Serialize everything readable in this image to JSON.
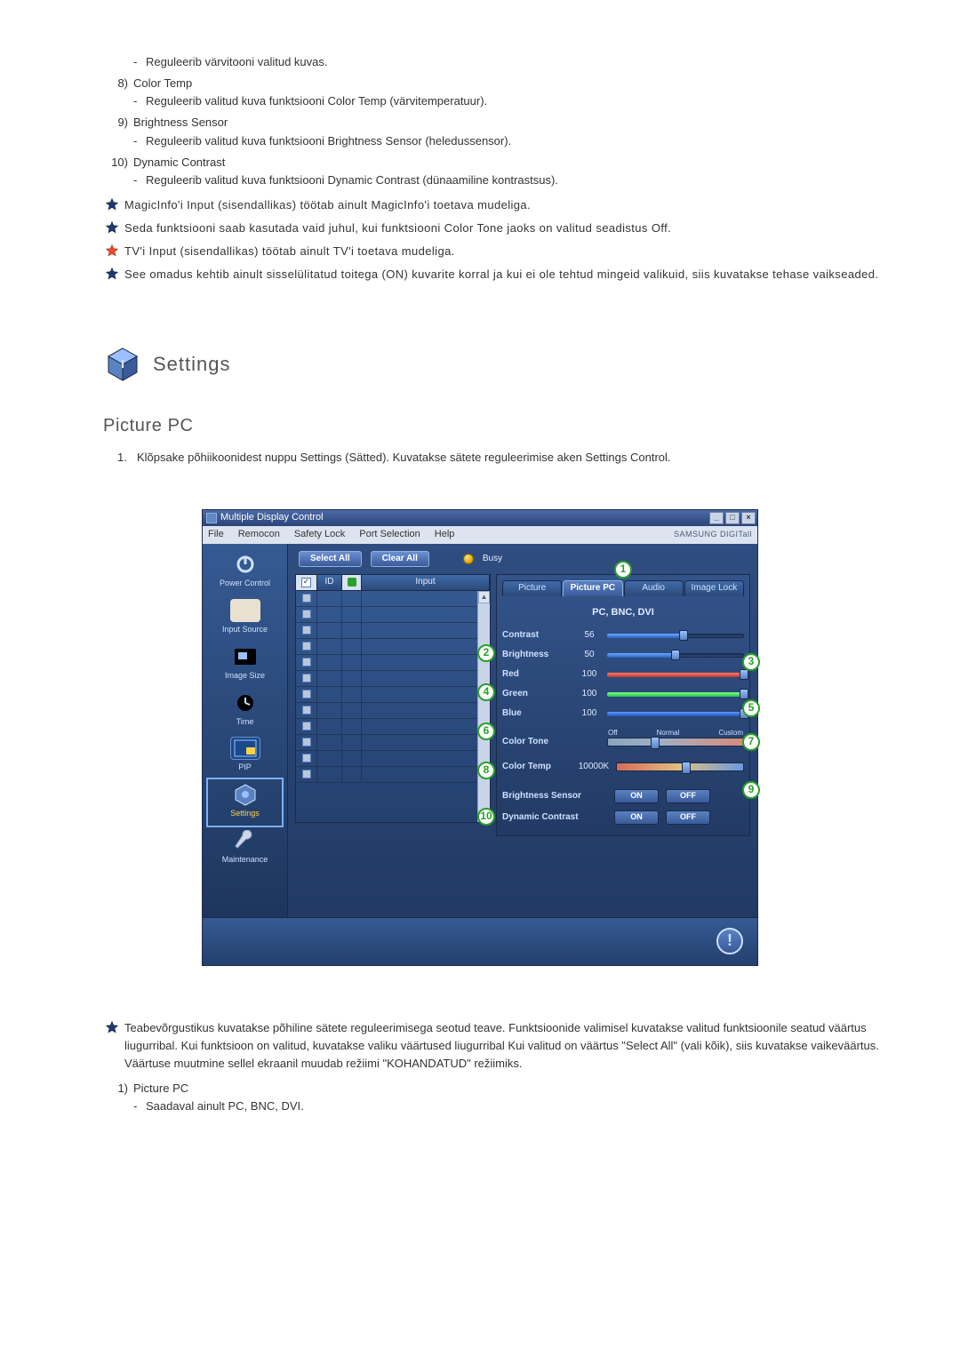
{
  "top_list": {
    "item0_sub": "Reguleerib värvitooni valitud kuvas.",
    "items": [
      {
        "num": "8)",
        "label": "Color Temp",
        "desc": "Reguleerib valitud kuva funktsiooni Color Temp (värvitemperatuur)."
      },
      {
        "num": "9)",
        "label": "Brightness Sensor",
        "desc": "Reguleerib valitud kuva funktsiooni Brightness Sensor (heledussensor)."
      },
      {
        "num": "10)",
        "label": "Dynamic Contrast",
        "desc": "Reguleerib valitud kuva funktsiooni Dynamic Contrast (dünaamiline kontrastsus)."
      }
    ]
  },
  "footnotes": [
    {
      "color": "navy",
      "text": "MagicInfo'i Input (sisendallikas) töötab ainult MagicInfo'i toetava mudeliga."
    },
    {
      "color": "navy",
      "text": "Seda funktsiooni saab kasutada vaid juhul, kui funktsiooni Color Tone jaoks on valitud seadistus Off."
    },
    {
      "color": "red",
      "text": "TV'i Input (sisendallikas) töötab ainult TV'i toetava mudeliga."
    },
    {
      "color": "navy",
      "text": "See omadus kehtib ainult sisselülitatud toitega (ON) kuvarite korral ja kui ei ole tehtud mingeid valikuid, siis kuvatakse tehase vaikseaded."
    }
  ],
  "settings_section": {
    "title": "Settings",
    "subheading": "Picture PC",
    "step_num": "1.",
    "step_text": "Klõpsake põhiikoonidest nuppu Settings (Sätted). Kuvatakse sätete reguleerimise aken Settings Control."
  },
  "mdc": {
    "title": "Multiple Display Control",
    "window_buttons": {
      "min": "_",
      "max": "□",
      "close": "×"
    },
    "menu": [
      "File",
      "Remocon",
      "Safety Lock",
      "Port Selection",
      "Help"
    ],
    "brand": "SAMSUNG DIGITall",
    "sidebar": [
      "Power Control",
      "Input Source",
      "Image Size",
      "Time",
      "PIP",
      "Settings",
      "Maintenance"
    ],
    "buttons": {
      "select_all": "Select All",
      "clear_all": "Clear All",
      "busy": "Busy"
    },
    "list_header": {
      "chk": "✓",
      "id": "ID",
      "input": "Input"
    },
    "tabs": [
      "Picture",
      "Picture PC",
      "Audio",
      "Image Lock"
    ],
    "active_tab": 1,
    "panel_sub": "PC, BNC, DVI",
    "sliders": [
      {
        "label": "Contrast",
        "value": "56",
        "pct": 56,
        "fill": "fill-blue"
      },
      {
        "label": "Brightness",
        "value": "50",
        "pct": 50,
        "fill": "fill-blue"
      },
      {
        "label": "Red",
        "value": "100",
        "pct": 100,
        "fill": "fill-red"
      },
      {
        "label": "Green",
        "value": "100",
        "pct": 100,
        "fill": "fill-green"
      },
      {
        "label": "Blue",
        "value": "100",
        "pct": 100,
        "fill": "fill-darkblue"
      }
    ],
    "color_tone": {
      "label": "Color Tone",
      "ticks": [
        "Off",
        "Normal",
        "Custom"
      ],
      "pos_pct": 35
    },
    "color_temp": {
      "label": "Color Temp",
      "value": "10000K",
      "pos_pct": 55
    },
    "toggles": [
      {
        "label": "Brightness Sensor",
        "on": "ON",
        "off": "OFF"
      },
      {
        "label": "Dynamic Contrast",
        "on": "ON",
        "off": "OFF"
      }
    ],
    "annotations": [
      "1",
      "2",
      "3",
      "4",
      "5",
      "6",
      "7",
      "8",
      "9",
      "10"
    ]
  },
  "post_note": "Teabevõrgustikus kuvatakse põhiline sätete reguleerimisega seotud teave. Funktsioonide valimisel kuvatakse valitud funktsioonile seatud väärtus liugurribal. Kui funktsioon on valitud, kuvatakse valiku väärtused liugurribal Kui valitud on väärtus \"Select All\" (vali kõik), siis kuvatakse vaikeväärtus. Väärtuse muutmine sellel ekraanil muudab režiimi \"KOHANDATUD\" režiimiks.",
  "post_list": {
    "num": "1)",
    "label": "Picture PC",
    "desc": "Saadaval ainult PC, BNC, DVI."
  }
}
